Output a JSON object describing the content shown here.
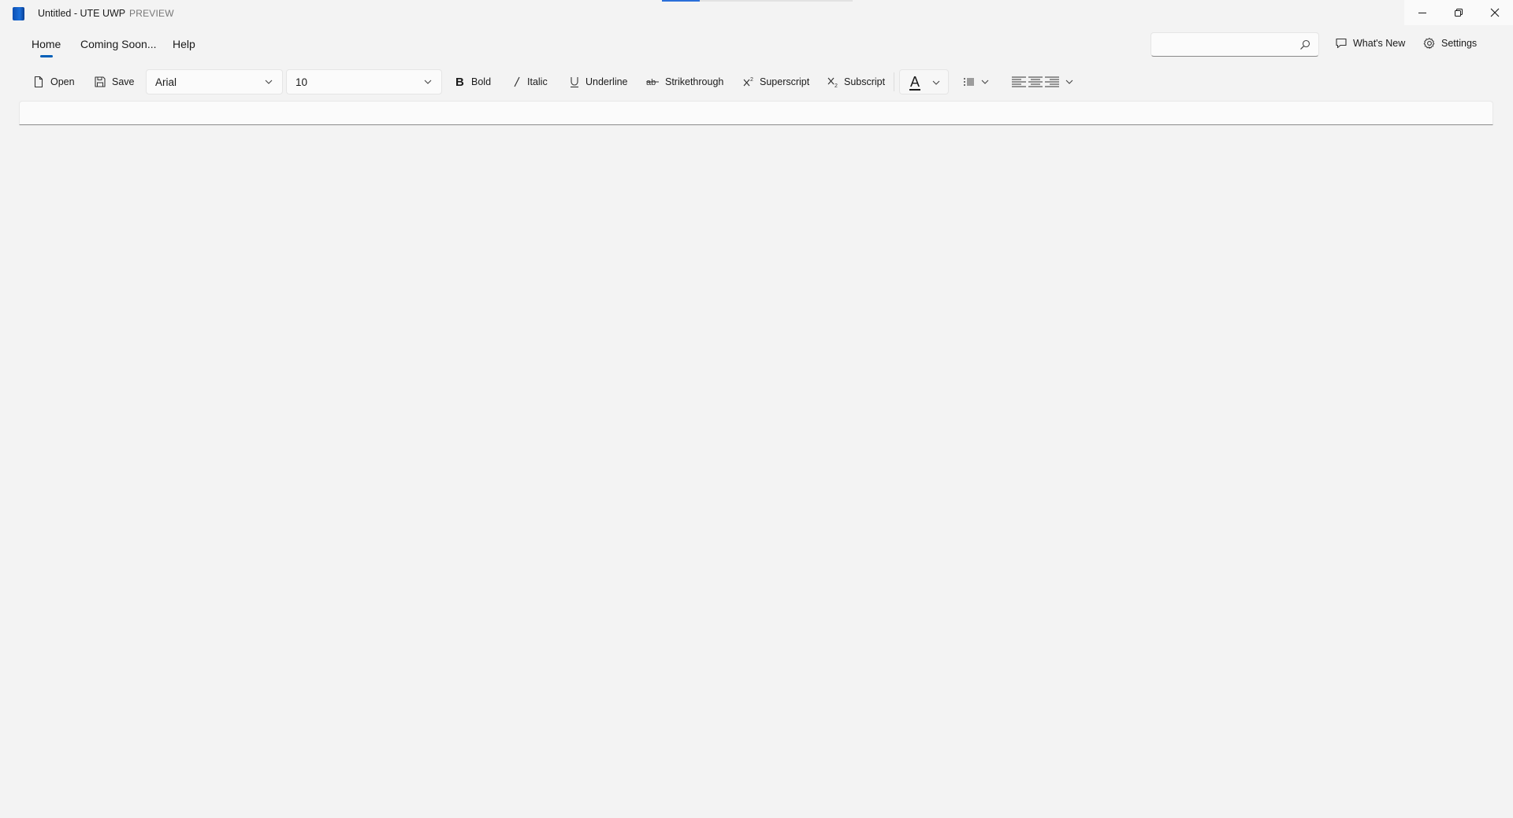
{
  "titlebar": {
    "title": "Untitled - UTE UWP",
    "badge": "PREVIEW",
    "icons": [
      "app-icon",
      "minimize-icon",
      "restore-icon",
      "close-icon"
    ]
  },
  "nav": {
    "tabs": [
      {
        "label": "Home",
        "active": true
      },
      {
        "label": "Coming Soon...",
        "active": false
      },
      {
        "label": "Help",
        "active": false
      }
    ],
    "search": {
      "value": "",
      "placeholder": ""
    },
    "whats_new_label": "What's New",
    "settings_label": "Settings"
  },
  "toolbar": {
    "open_label": "Open",
    "save_label": "Save",
    "font_family": "Arial",
    "font_size": "10",
    "bold_label": "Bold",
    "italic_label": "Italic",
    "underline_label": "Underline",
    "strikethrough_label": "Strikethrough",
    "superscript_label": "Superscript",
    "subscript_label": "Subscript",
    "font_color_glyph": "A"
  },
  "colors": {
    "accent": "#005fb8",
    "background": "#f3f3f3"
  }
}
